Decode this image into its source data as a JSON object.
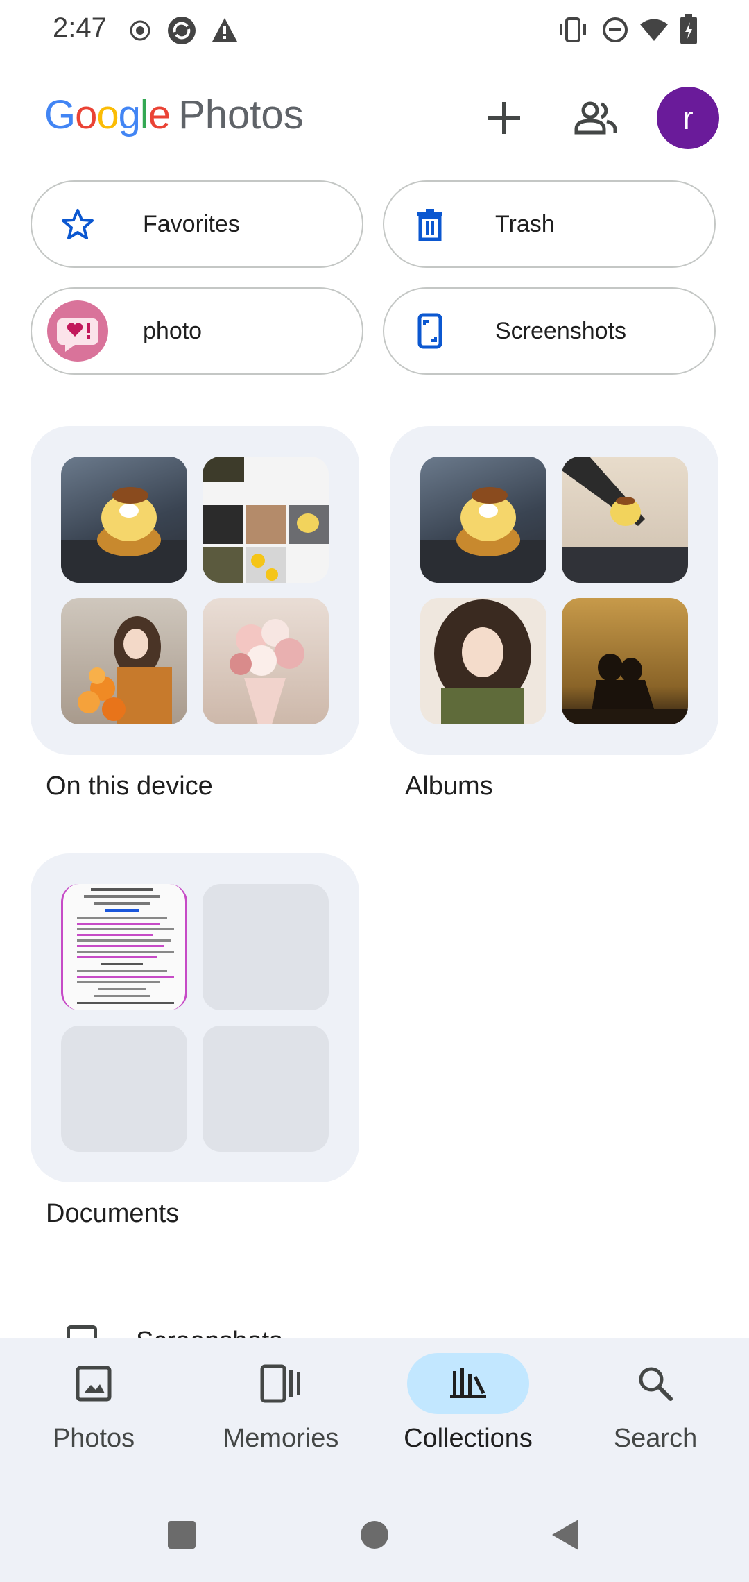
{
  "status_bar": {
    "time": "2:47"
  },
  "header": {
    "logo_letters": [
      "G",
      "o",
      "o",
      "g",
      "l",
      "e"
    ],
    "logo_product": "Photos",
    "add_icon": "plus-icon",
    "sharing_icon": "people-icon",
    "avatar_letter": "r"
  },
  "chips": [
    {
      "label": "Favorites",
      "icon": "star-icon"
    },
    {
      "label": "Trash",
      "icon": "trash-icon"
    },
    {
      "label": "photo",
      "icon": "album-cover-image"
    },
    {
      "label": "Screenshots",
      "icon": "screenshot-icon"
    }
  ],
  "cards": [
    {
      "label": "On this device"
    },
    {
      "label": "Albums"
    },
    {
      "label": "Documents"
    }
  ],
  "peek_label": "Screenshots",
  "bottom_nav": [
    {
      "label": "Photos",
      "icon": "photo-icon"
    },
    {
      "label": "Memories",
      "icon": "memories-icon"
    },
    {
      "label": "Collections",
      "icon": "collections-icon",
      "active": true
    },
    {
      "label": "Search",
      "icon": "search-icon"
    }
  ],
  "colors": {
    "accent": "#0b57d0",
    "avatar": "#6a1b9a",
    "active_pill": "#c2e7ff",
    "nav_bg": "#eef1f7"
  }
}
